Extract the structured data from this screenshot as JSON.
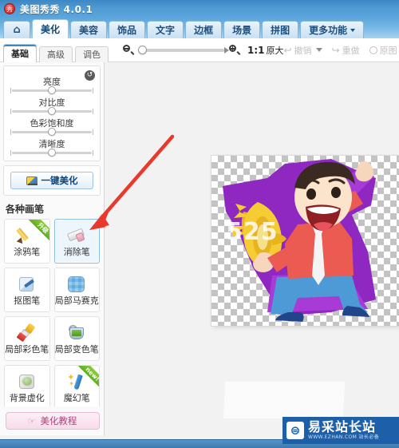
{
  "window": {
    "title": "美图秀秀 4.0.1",
    "logo_glyph": "秀",
    "logo_icon_name": "app-logo-icon"
  },
  "main_tabs": [
    {
      "label": "⌂",
      "name": "home",
      "active": false,
      "icon": "home-icon"
    },
    {
      "label": "美化",
      "name": "beautify",
      "active": true
    },
    {
      "label": "美容",
      "name": "retouch",
      "active": false
    },
    {
      "label": "饰品",
      "name": "decorations",
      "active": false
    },
    {
      "label": "文字",
      "name": "text",
      "active": false
    },
    {
      "label": "边框",
      "name": "frames",
      "active": false
    },
    {
      "label": "场景",
      "name": "scenes",
      "active": false
    },
    {
      "label": "拼图",
      "name": "collage",
      "active": false
    },
    {
      "label": "更多功能",
      "name": "more-features",
      "active": false,
      "caret": true
    }
  ],
  "sub_tabs": [
    {
      "label": "基础",
      "active": true
    },
    {
      "label": "高级",
      "active": false
    },
    {
      "label": "调色",
      "active": false
    }
  ],
  "toolbar": {
    "zoom_out_icon": "zoom-out-icon",
    "zoom_in_icon": "zoom-in-icon",
    "zoom_value": 0,
    "ratio_label": "1:1",
    "ratio_suffix": "原大",
    "undo_label": "撤销",
    "redo_label": "重做",
    "original_label": "原图",
    "undo_icon": "undo-icon",
    "redo_icon": "redo-icon",
    "original_icon": "original-image-icon",
    "history_disabled": true
  },
  "adjustments": {
    "reset_icon": "reset-icon",
    "reset_glyph": "↺",
    "sliders": [
      {
        "label": "亮度",
        "value": 50
      },
      {
        "label": "对比度",
        "value": 50
      },
      {
        "label": "色彩饱和度",
        "value": 50
      },
      {
        "label": "清晰度",
        "value": 50
      }
    ]
  },
  "beautify": {
    "button_label": "一键美化",
    "button_icon": "auto-beautify-icon"
  },
  "brushes": {
    "section_title": "各种画笔",
    "items": [
      {
        "label": "涂鸦笔",
        "icon": "graffiti-pen-icon",
        "badge": "升级",
        "selected": false
      },
      {
        "label": "消除笔",
        "icon": "eraser-pen-icon",
        "badge": "",
        "selected": true
      },
      {
        "label": "抠图笔",
        "icon": "cutout-pen-icon",
        "badge": "",
        "selected": false
      },
      {
        "label": "局部马赛克",
        "icon": "local-mosaic-icon",
        "badge": "",
        "selected": false
      },
      {
        "label": "局部彩色笔",
        "icon": "local-color-pen-icon",
        "badge": "",
        "selected": false
      },
      {
        "label": "局部变色笔",
        "icon": "local-recolor-pen-icon",
        "badge": "",
        "selected": false
      },
      {
        "label": "背景虚化",
        "icon": "background-blur-icon",
        "badge": "",
        "selected": false
      },
      {
        "label": "魔幻笔",
        "icon": "magic-pen-icon",
        "badge": "new!",
        "selected": false
      }
    ]
  },
  "tutorial": {
    "label": "美化教程",
    "icon": "tutorial-hand-icon",
    "glyph": "☞"
  },
  "canvas": {
    "image_name": "cartoon-man-with-megaphone",
    "overlay_text": "525",
    "transparent_background": true
  },
  "watermark": {
    "logo_glyph": "⊜",
    "cn_text": "易采站长站",
    "en_text": "WWW.EZHAN.COM  站长必备",
    "icon": "site-watermark-logo"
  },
  "annotation": {
    "arrow_color": "#e8392c",
    "arrow_name": "red-pointer-arrow",
    "points_to": "eraser-pen-icon"
  },
  "colors": {
    "titlebar_blue": "#4f9ad4",
    "tab_blue": "#7bbbe6",
    "accent_red": "#e8392c",
    "panel_bg": "#fafafa",
    "workspace_bg": "#f2f2f2",
    "selected_brush_bg": "#eef6fd",
    "watermark_blue": "#1d5fa8"
  }
}
